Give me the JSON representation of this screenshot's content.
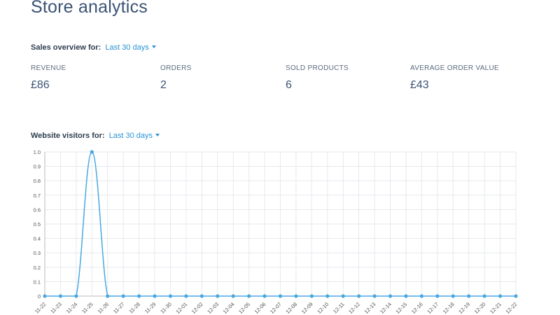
{
  "page": {
    "title": "Store analytics"
  },
  "sales_overview": {
    "label": "Sales overview for:",
    "period": "Last 30 days",
    "stats": [
      {
        "label": "REVENUE",
        "value": "£86"
      },
      {
        "label": "ORDERS",
        "value": "2"
      },
      {
        "label": "SOLD PRODUCTS",
        "value": "6"
      },
      {
        "label": "AVERAGE ORDER VALUE",
        "value": "£43"
      }
    ]
  },
  "visitors": {
    "label": "Website visitors for:",
    "period": "Last 30 days"
  },
  "colors": {
    "accent": "#2a93d5",
    "line": "#4aa8e0",
    "title": "#3b5375",
    "grid": "#e6e9ed"
  },
  "chart_data": {
    "type": "line",
    "categories": [
      "11-22",
      "11-23",
      "11-24",
      "11-25",
      "11-26",
      "11-27",
      "11-28",
      "11-29",
      "11-30",
      "12-01",
      "12-02",
      "12-03",
      "12-04",
      "12-05",
      "12-06",
      "12-07",
      "12-08",
      "12-09",
      "12-10",
      "12-11",
      "12-12",
      "12-13",
      "12-14",
      "12-15",
      "12-16",
      "12-17",
      "12-18",
      "12-19",
      "12-20",
      "12-21",
      "12-22"
    ],
    "series": [
      {
        "values": [
          0,
          0,
          0,
          1,
          0,
          0,
          0,
          0,
          0,
          0,
          0,
          0,
          0,
          0,
          0,
          0,
          0,
          0,
          0,
          0,
          0,
          0,
          0,
          0,
          0,
          0,
          0,
          0,
          0,
          0,
          0
        ]
      }
    ],
    "y_ticks": [
      "0",
      "0.1",
      "0.2",
      "0.3",
      "0.4",
      "0.5",
      "0.6",
      "0.7",
      "0.8",
      "0.9",
      "1.0"
    ],
    "ylim": [
      0,
      1
    ],
    "grid": true,
    "title": "",
    "xlabel": "",
    "ylabel": ""
  }
}
